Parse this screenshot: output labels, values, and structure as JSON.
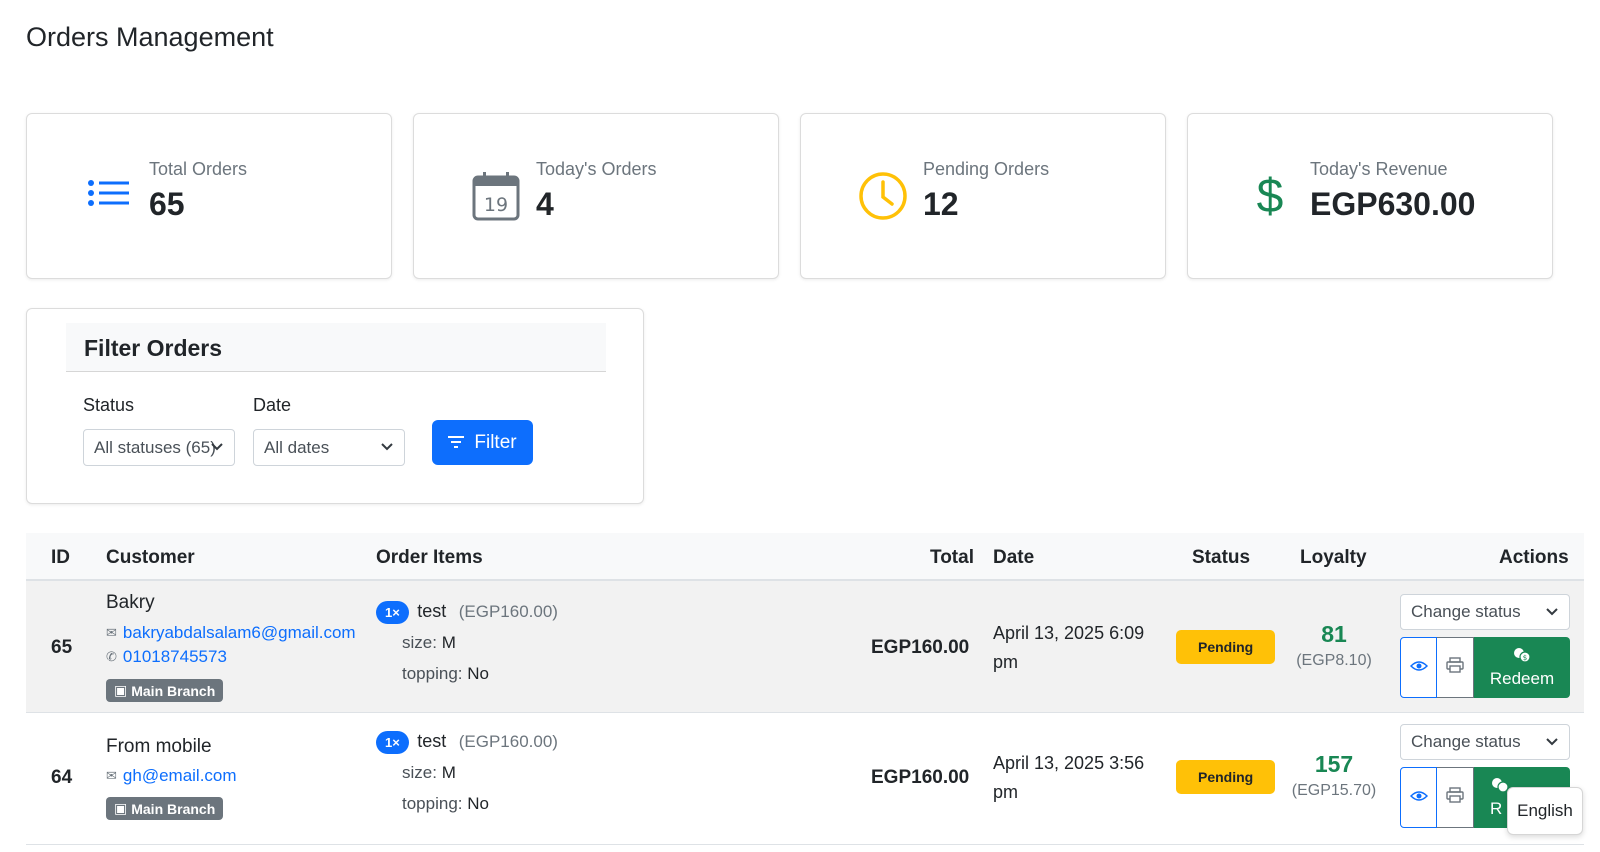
{
  "page": {
    "title": "Orders Management"
  },
  "stats": [
    {
      "label": "Total Orders",
      "value": "65",
      "icon": "list-icon",
      "color": "#0d6efd"
    },
    {
      "label": "Today's Orders",
      "value": "4",
      "icon": "calendar-icon",
      "icon_text": "19",
      "color": "#6c757d"
    },
    {
      "label": "Pending Orders",
      "value": "12",
      "icon": "clock-icon",
      "color": "#ffc107"
    },
    {
      "label": "Today's Revenue",
      "value": "EGP630.00",
      "icon": "dollar-icon",
      "color": "#198754"
    }
  ],
  "filter": {
    "title": "Filter Orders",
    "status_label": "Status",
    "status_value": "All statuses (65)",
    "date_label": "Date",
    "date_value": "All dates",
    "button_label": "Filter"
  },
  "table": {
    "headers": {
      "id": "ID",
      "customer": "Customer",
      "items": "Order Items",
      "total": "Total",
      "date": "Date",
      "status": "Status",
      "loyalty": "Loyalty",
      "actions": "Actions"
    },
    "rows": [
      {
        "id": "65",
        "customer_name": "Bakry",
        "email": "bakryabdalsalam6@gmail.com",
        "phone": "01018745573",
        "branch": "Main Branch",
        "item_qty": "1×",
        "item_name": "test",
        "item_price": "(EGP160.00)",
        "opt1_label": "size:",
        "opt1_value": "M",
        "opt2_label": "topping:",
        "opt2_value": "No",
        "total": "EGP160.00",
        "date": "April 13, 2025 6:09 pm",
        "status": "Pending",
        "loyalty_points": "81",
        "loyalty_value": "(EGP8.10)",
        "status_select": "Change status",
        "redeem_label": "Redeem"
      },
      {
        "id": "64",
        "customer_name": "From mobile",
        "email": "gh@email.com",
        "branch": "Main Branch",
        "item_qty": "1×",
        "item_name": "test",
        "item_price": "(EGP160.00)",
        "opt1_label": "size:",
        "opt1_value": "M",
        "opt2_label": "topping:",
        "opt2_value": "No",
        "total": "EGP160.00",
        "date": "April 13, 2025 3:56 pm",
        "status": "Pending",
        "loyalty_points": "157",
        "loyalty_value": "(EGP15.70)",
        "status_select": "Change status",
        "redeem_label": "R"
      }
    ]
  },
  "language": {
    "label": "English"
  }
}
